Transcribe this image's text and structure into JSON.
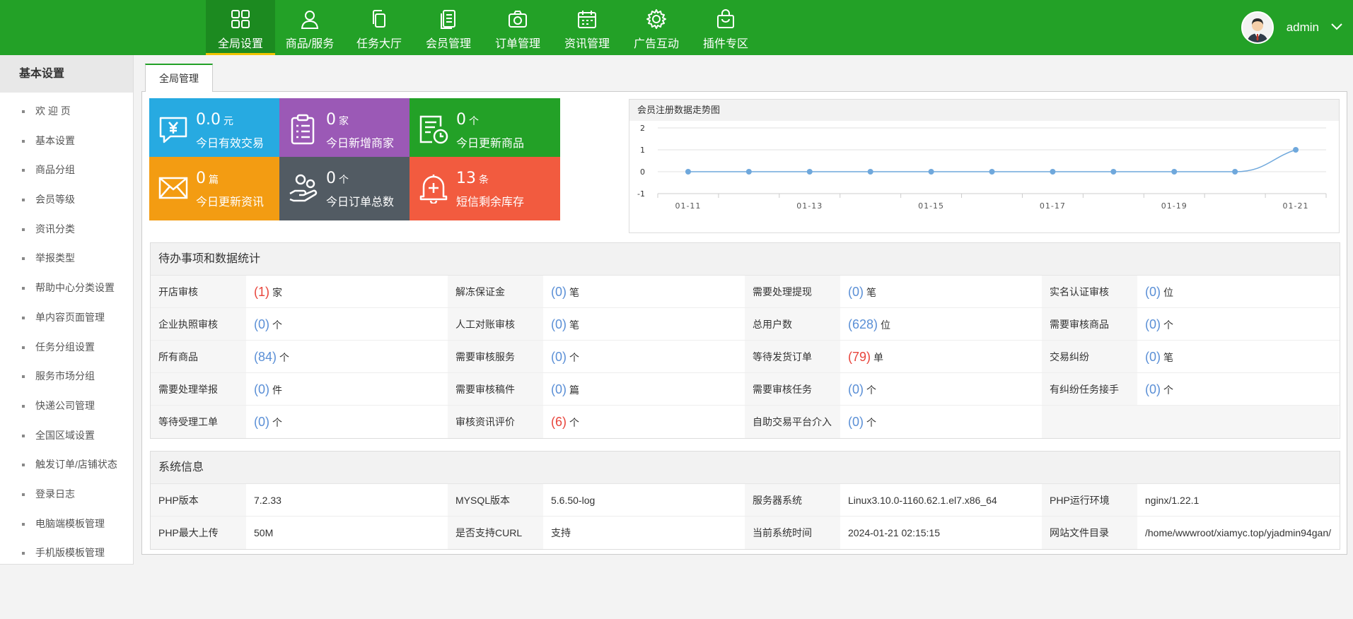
{
  "nav": [
    {
      "label": "全局设置",
      "icon": "grid-icon",
      "active": true
    },
    {
      "label": "商品/服务",
      "icon": "user-icon",
      "active": false
    },
    {
      "label": "任务大厅",
      "icon": "copy-icon",
      "active": false
    },
    {
      "label": "会员管理",
      "icon": "document-icon",
      "active": false
    },
    {
      "label": "订单管理",
      "icon": "camera-icon",
      "active": false
    },
    {
      "label": "资讯管理",
      "icon": "calendar-icon",
      "active": false
    },
    {
      "label": "广告互动",
      "icon": "gear-icon",
      "active": false
    },
    {
      "label": "插件专区",
      "icon": "bag-icon",
      "active": false
    }
  ],
  "user": {
    "name": "admin"
  },
  "sidebar": {
    "title": "基本设置",
    "items": [
      "欢 迎 页",
      "基本设置",
      "商品分组",
      "会员等级",
      "资讯分类",
      "举报类型",
      "帮助中心分类设置",
      "单内容页面管理",
      "任务分组设置",
      "服务市场分组",
      "快递公司管理",
      "全国区域设置",
      "触发订单/店铺状态",
      "登录日志",
      "电脑端模板管理",
      "手机版模板管理"
    ]
  },
  "tab": {
    "label": "全局管理"
  },
  "cards": [
    {
      "value": "0.0",
      "unit": "元",
      "label": "今日有效交易",
      "color": "#27aae1",
      "icon": "money-chat-icon"
    },
    {
      "value": "0",
      "unit": "家",
      "label": "今日新增商家",
      "color": "#9b59b6",
      "icon": "clipboard-icon"
    },
    {
      "value": "0",
      "unit": "个",
      "label": "今日更新商品",
      "color": "#23a127",
      "icon": "doc-clock-icon"
    },
    {
      "value": "0",
      "unit": "篇",
      "label": "今日更新资讯",
      "color": "#f39c12",
      "icon": "mail-icon"
    },
    {
      "value": "0",
      "unit": "个",
      "label": "今日订单总数",
      "color": "#525b63",
      "icon": "hand-coins-icon"
    },
    {
      "value": "13",
      "unit": "条",
      "label": "短信剩余库存",
      "color": "#f25b3f",
      "icon": "bell-plus-icon"
    }
  ],
  "chart_data": {
    "type": "line",
    "title": "会员注册数据走势图",
    "x": [
      "01-11",
      "01-12",
      "01-13",
      "01-14",
      "01-15",
      "01-16",
      "01-17",
      "01-18",
      "01-19",
      "01-20",
      "01-21"
    ],
    "x_tick_labels": [
      "01-11",
      "01-13",
      "01-15",
      "01-17",
      "01-19",
      "01-21"
    ],
    "values": [
      0,
      0,
      0,
      0,
      0,
      0,
      0,
      0,
      0,
      0,
      1
    ],
    "ylim": [
      -1,
      2
    ],
    "y_ticks": [
      "2",
      "1",
      "0",
      "-1"
    ],
    "grid": true,
    "line_color": "#6fa8dc"
  },
  "todo": {
    "title": "待办事项和数据统计",
    "rows": [
      [
        {
          "label": "开店审核",
          "value": "(1)",
          "unit": "家",
          "red": true
        },
        {
          "label": "解冻保证金",
          "value": "(0)",
          "unit": "笔",
          "red": false
        },
        {
          "label": "需要处理提现",
          "value": "(0)",
          "unit": "笔",
          "red": false
        },
        {
          "label": "实名认证审核",
          "value": "(0)",
          "unit": "位",
          "red": false
        }
      ],
      [
        {
          "label": "企业执照审核",
          "value": "(0)",
          "unit": "个",
          "red": false
        },
        {
          "label": "人工对账审核",
          "value": "(0)",
          "unit": "笔",
          "red": false
        },
        {
          "label": "总用户数",
          "value": "(628)",
          "unit": "位",
          "red": false
        },
        {
          "label": "需要审核商品",
          "value": "(0)",
          "unit": "个",
          "red": false
        }
      ],
      [
        {
          "label": "所有商品",
          "value": "(84)",
          "unit": "个",
          "red": false
        },
        {
          "label": "需要审核服务",
          "value": "(0)",
          "unit": "个",
          "red": false
        },
        {
          "label": "等待发货订单",
          "value": "(79)",
          "unit": "单",
          "red": true
        },
        {
          "label": "交易纠纷",
          "value": "(0)",
          "unit": "笔",
          "red": false
        }
      ],
      [
        {
          "label": "需要处理举报",
          "value": "(0)",
          "unit": "件",
          "red": false
        },
        {
          "label": "需要审核稿件",
          "value": "(0)",
          "unit": "篇",
          "red": false
        },
        {
          "label": "需要审核任务",
          "value": "(0)",
          "unit": "个",
          "red": false
        },
        {
          "label": "有纠纷任务接手",
          "value": "(0)",
          "unit": "个",
          "red": false
        }
      ],
      [
        {
          "label": "等待受理工单",
          "value": "(0)",
          "unit": "个",
          "red": false
        },
        {
          "label": "审核资讯评价",
          "value": "(6)",
          "unit": "个",
          "red": true
        },
        {
          "label": "自助交易平台介入",
          "value": "(0)",
          "unit": "个",
          "red": false
        }
      ]
    ]
  },
  "sysinfo": {
    "title": "系统信息",
    "rows": [
      [
        {
          "label": "PHP版本",
          "value": "7.2.33"
        },
        {
          "label": "MYSQL版本",
          "value": "5.6.50-log"
        },
        {
          "label": "服务器系统",
          "value": "Linux3.10.0-1160.62.1.el7.x86_64"
        },
        {
          "label": "PHP运行环境",
          "value": "nginx/1.22.1"
        }
      ],
      [
        {
          "label": "PHP最大上传",
          "value": "50M"
        },
        {
          "label": "是否支持CURL",
          "value": "支持"
        },
        {
          "label": "当前系统时间",
          "value": "2024-01-21 02:15:15"
        },
        {
          "label": "网站文件目录",
          "value": "/home/wwwroot/xiamyc.top/yjadmin94gan/"
        }
      ]
    ]
  }
}
